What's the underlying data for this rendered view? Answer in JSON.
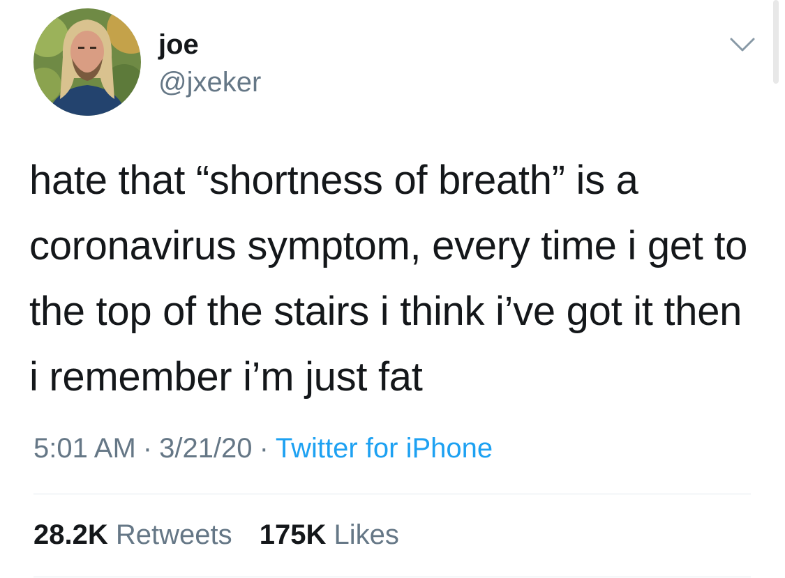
{
  "author": {
    "display_name": "joe",
    "handle": "@jxeker",
    "avatar_icon": "profile-photo"
  },
  "tweet": {
    "text": "hate that “shortness of breath” is a coronavirus symptom, every time i get to the top of the stairs i think i’ve got it then i remember i’m just fat",
    "time": "5:01 AM",
    "separator": "·",
    "date": "3/21/20",
    "source": "Twitter for iPhone"
  },
  "stats": {
    "retweets_count": "28.2K",
    "retweets_label": "Retweets",
    "likes_count": "175K",
    "likes_label": "Likes"
  },
  "menu": {
    "icon": "chevron-down-icon"
  },
  "colors": {
    "text": "#14171a",
    "secondary": "#657786",
    "link": "#1da1f2",
    "divider": "#e1e8ed"
  }
}
